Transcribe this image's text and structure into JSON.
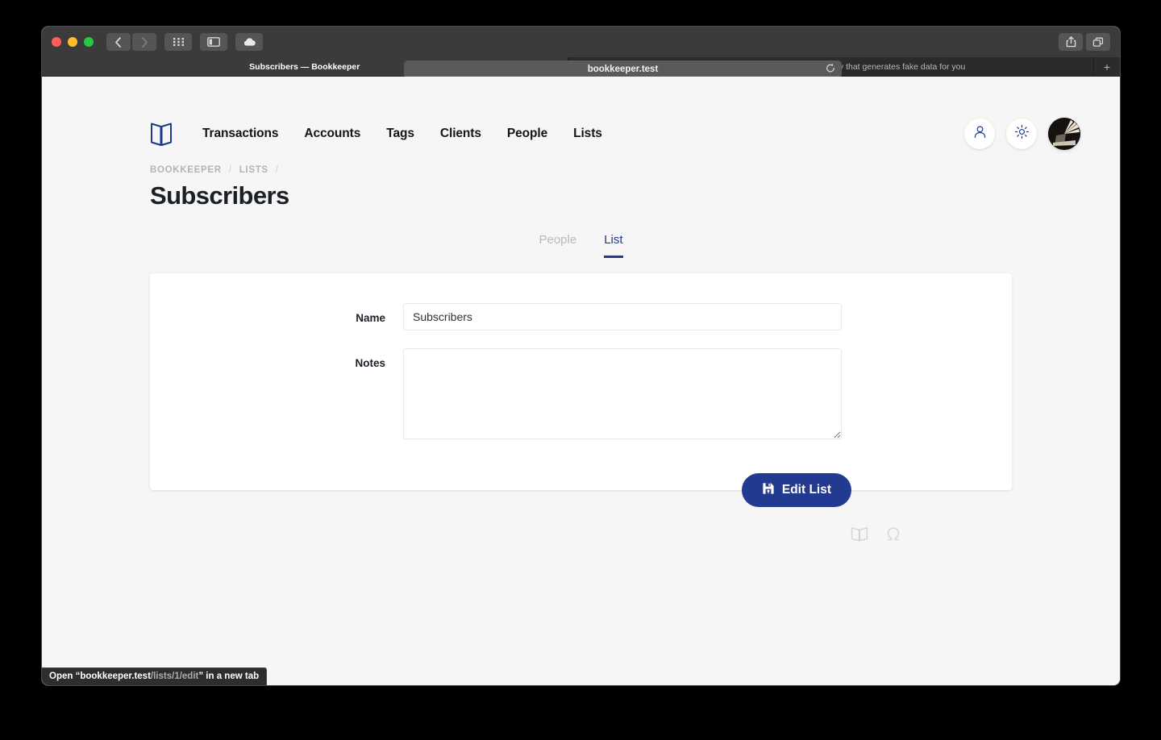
{
  "browser": {
    "url": "bookkeeper.test",
    "toolbar_icons": {
      "back": "back-chevron-icon",
      "forward": "forward-chevron-icon",
      "grid": "tab-grid-icon",
      "sidebar": "sidebar-toggle-icon",
      "icloud": "icloud-icon",
      "share": "share-icon",
      "tab_overview": "tab-overview-icon",
      "reload": "reload-icon",
      "new_tab": "+"
    },
    "tabs": [
      {
        "title": "Subscribers — Bookkeeper",
        "active": true
      },
      {
        "title": "fzaninotto/Faker: Faker is a PHP library that generates fake data for you",
        "active": false
      }
    ],
    "status_tip": {
      "prefix": "Open “",
      "host": "bookkeeper.test",
      "path": "/lists/1/edit",
      "suffix": "” in a new tab"
    }
  },
  "header": {
    "logo_name": "bookkeeper-logo",
    "nav": [
      {
        "label": "Transactions"
      },
      {
        "label": "Accounts"
      },
      {
        "label": "Tags"
      },
      {
        "label": "Clients"
      },
      {
        "label": "People"
      },
      {
        "label": "Lists"
      }
    ],
    "actions": [
      {
        "name": "profile-icon"
      },
      {
        "name": "gear-icon"
      }
    ],
    "avatar_name": "user-avatar"
  },
  "breadcrumb": {
    "items": [
      "BOOKKEEPER",
      "LISTS"
    ],
    "separator": "/"
  },
  "page": {
    "title": "Subscribers"
  },
  "tabs": [
    {
      "label": "People",
      "active": false
    },
    {
      "label": "List",
      "active": true
    }
  ],
  "form": {
    "name": {
      "label": "Name",
      "value": "Subscribers",
      "placeholder": ""
    },
    "notes": {
      "label": "Notes",
      "value": "",
      "placeholder": ""
    },
    "submit": {
      "label": "Edit List",
      "icon": "save-icon"
    }
  },
  "footer": {
    "icons": [
      {
        "name": "bookkeeper-mark-icon"
      },
      {
        "name": "omega-icon"
      }
    ]
  },
  "colors": {
    "accent": "#223a8f",
    "page_bg": "#f6f6f6",
    "card_bg": "#ffffff",
    "muted_text": "#b6bac0"
  }
}
